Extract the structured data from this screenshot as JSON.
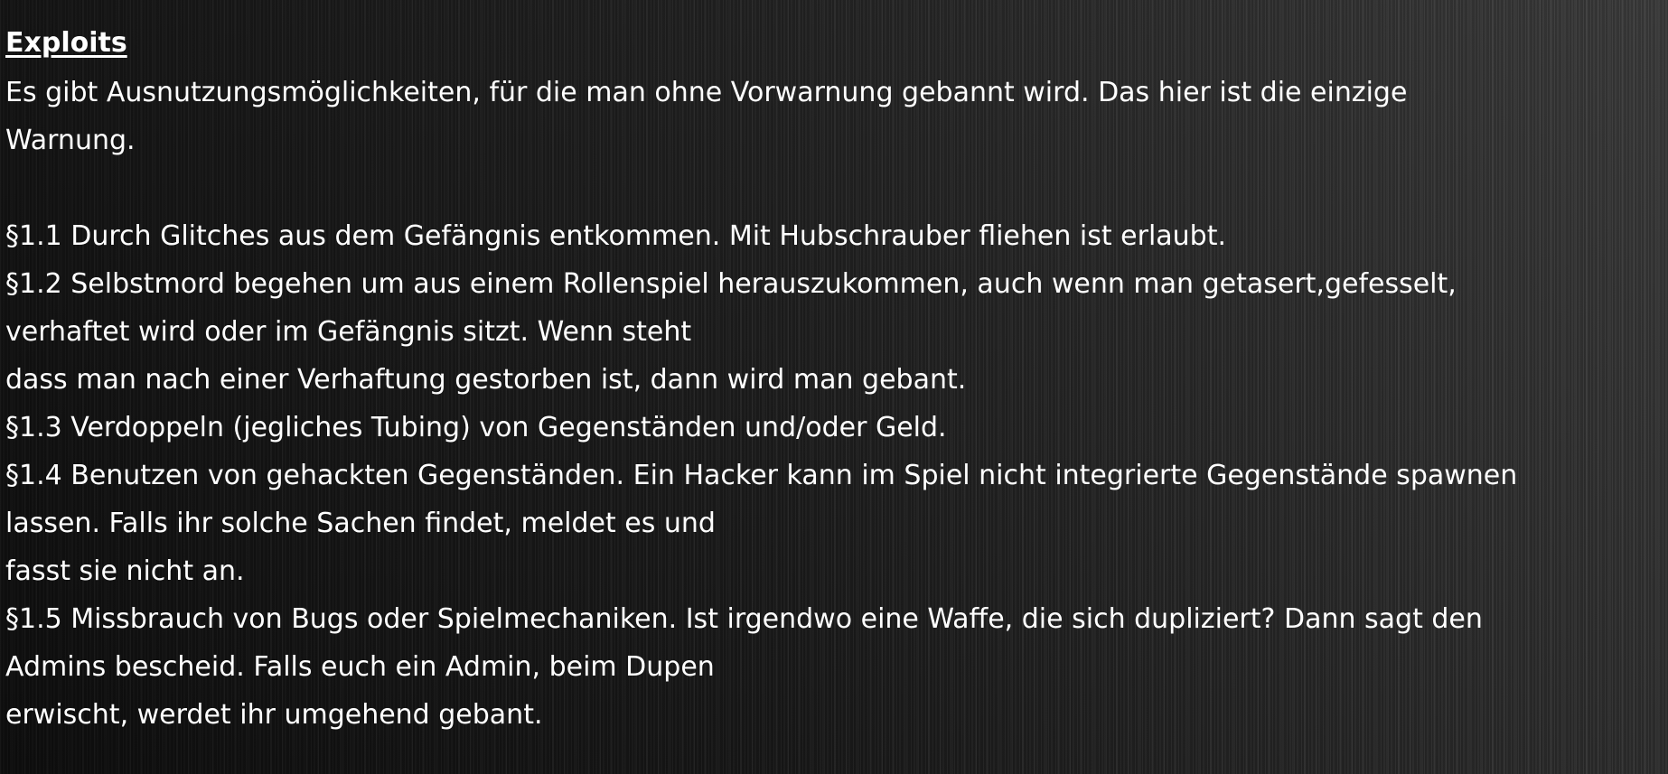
{
  "heading": "Exploits",
  "intro": {
    "line1": "Es gibt Ausnutzungsmöglichkeiten, für die man ohne Vorwarnung gebannt wird. Das hier ist die einzige",
    "line2": "Warnung."
  },
  "rules": [
    {
      "lines": [
        "§1.1 Durch Glitches aus dem Gefängnis entkommen. Mit Hubschrauber fliehen ist erlaubt."
      ]
    },
    {
      "lines": [
        "§1.2 Selbstmord begehen um aus einem Rollenspiel herauszukommen, auch wenn man getasert,gefesselt,",
        "verhaftet wird oder im Gefängnis sitzt. Wenn steht",
        "dass man nach einer Verhaftung gestorben ist, dann wird man gebant."
      ]
    },
    {
      "lines": [
        "§1.3 Verdoppeln (jegliches Tubing) von Gegenständen und/oder Geld."
      ]
    },
    {
      "lines": [
        "§1.4 Benutzen von gehackten Gegenständen. Ein Hacker kann im Spiel nicht integrierte Gegenstände spawnen",
        "lassen. Falls ihr solche Sachen findet, meldet es und",
        "fasst sie nicht an."
      ]
    },
    {
      "lines": [
        "§1.5 Missbrauch von Bugs oder Spielmechaniken. Ist irgendwo eine Waffe, die sich dupliziert? Dann sagt den",
        "Admins bescheid. Falls euch ein Admin, beim Dupen",
        "erwischt, werdet ihr umgehend gebant."
      ]
    }
  ]
}
